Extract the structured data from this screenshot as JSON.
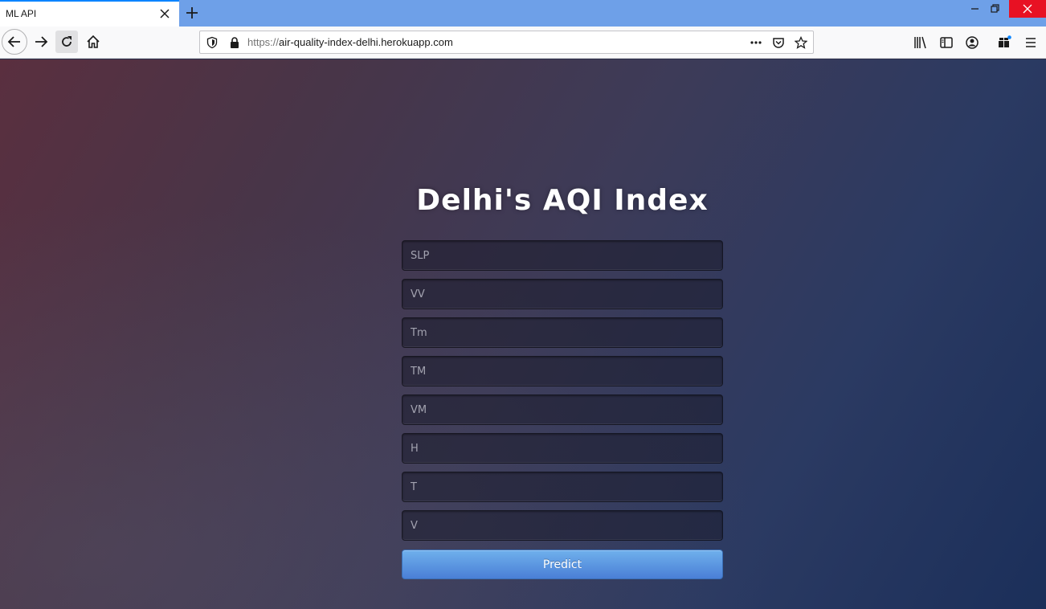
{
  "browser": {
    "tab_title": "ML API",
    "url_protocol": "https://",
    "url_host": "air-quality-index-delhi.herokuapp.com"
  },
  "page": {
    "title": "Delhi's AQI Index",
    "fields": [
      {
        "placeholder": "SLP"
      },
      {
        "placeholder": "VV"
      },
      {
        "placeholder": "Tm"
      },
      {
        "placeholder": "TM"
      },
      {
        "placeholder": "VM"
      },
      {
        "placeholder": "H"
      },
      {
        "placeholder": "T"
      },
      {
        "placeholder": "V"
      }
    ],
    "predict_label": "Predict"
  },
  "colors": {
    "accent": "#0a84ff",
    "tabstrip": "#6ea0e8",
    "button": "#5a93e0"
  }
}
